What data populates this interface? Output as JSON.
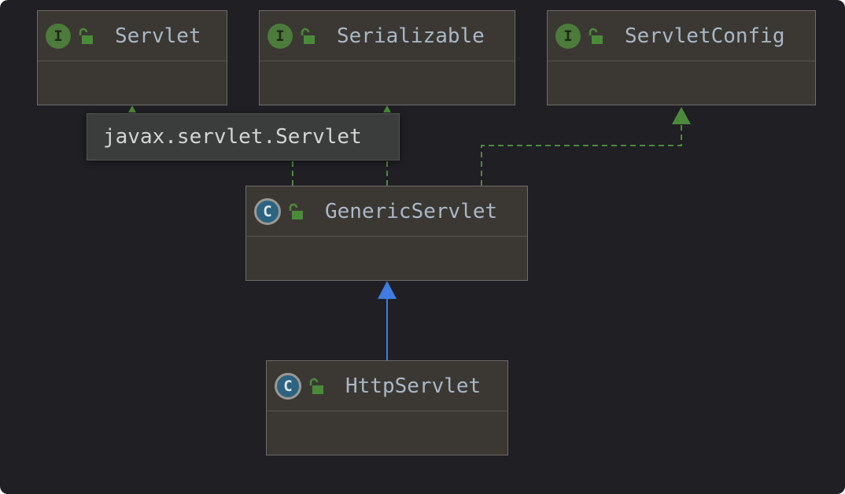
{
  "diagram": {
    "nodes": [
      {
        "id": "servlet",
        "title": "Servlet",
        "kind": "interface",
        "badge": "I"
      },
      {
        "id": "serializable",
        "title": "Serializable",
        "kind": "interface",
        "badge": "I"
      },
      {
        "id": "servlet_config",
        "title": "ServletConfig",
        "kind": "interface",
        "badge": "I"
      },
      {
        "id": "generic_servlet",
        "title": "GenericServlet",
        "kind": "class",
        "badge": "C"
      },
      {
        "id": "http_servlet",
        "title": "HttpServlet",
        "kind": "class",
        "badge": "C"
      }
    ],
    "edges": [
      {
        "from": "generic_servlet",
        "to": "servlet",
        "type": "implements"
      },
      {
        "from": "generic_servlet",
        "to": "serializable",
        "type": "implements"
      },
      {
        "from": "generic_servlet",
        "to": "servlet_config",
        "type": "implements"
      },
      {
        "from": "http_servlet",
        "to": "generic_servlet",
        "type": "extends"
      }
    ],
    "tooltip": {
      "text": "javax.servlet.Servlet"
    },
    "colors": {
      "background": "#1f1f24",
      "node_fill": "#3b3833",
      "implements_edge": "#4c8a3b",
      "extends_edge": "#3f7be0",
      "interface_badge": "#4c7b3b",
      "class_badge": "#2c6381",
      "title_text": "#a9b7c6"
    },
    "icons": {
      "interface": "interface-badge-icon",
      "class": "class-badge-icon",
      "visibility": "open-lock-icon"
    }
  }
}
